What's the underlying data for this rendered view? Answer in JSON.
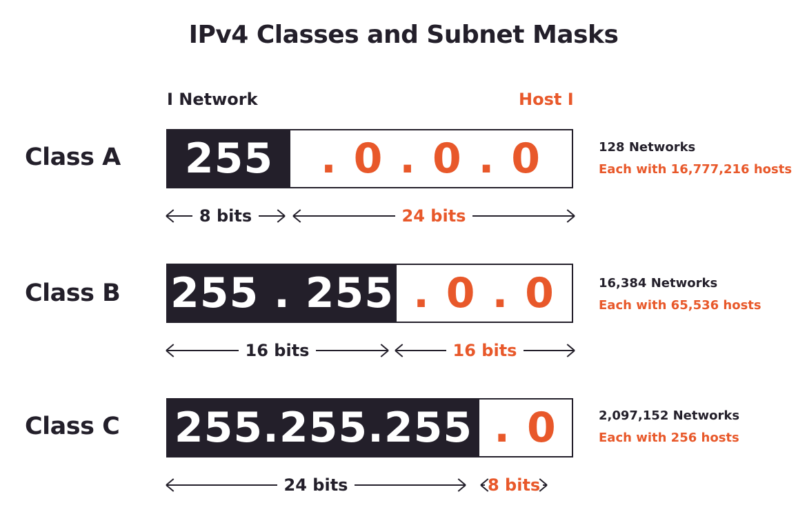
{
  "title": "IPv4 Classes and Subnet Masks",
  "columns": {
    "network": "I Network",
    "host": "Host I"
  },
  "colors": {
    "dark": "#231f2a",
    "accent": "#e8582a"
  },
  "classes": [
    {
      "label": "Class A",
      "network_part": "255",
      "host_part": ". 0 . 0 . 0",
      "networks": "128 Networks",
      "hosts": "Each with 16,777,216 hosts",
      "network_bits": "8 bits",
      "host_bits": "24 bits"
    },
    {
      "label": "Class B",
      "network_part": "255 . 255",
      "host_part": ". 0 . 0",
      "networks": "16,384 Networks",
      "hosts": "Each with 65,536 hosts",
      "network_bits": "16 bits",
      "host_bits": "16 bits"
    },
    {
      "label": "Class C",
      "network_part": "255.255.255",
      "host_part": ". 0",
      "networks": "2,097,152 Networks",
      "hosts": "Each with 256 hosts",
      "network_bits": "24 bits",
      "host_bits": "8 bits"
    }
  ]
}
